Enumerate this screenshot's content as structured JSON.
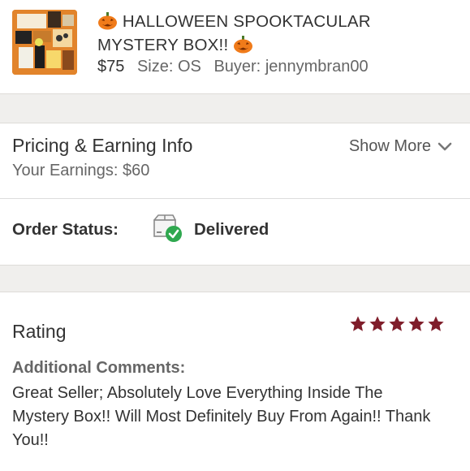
{
  "product": {
    "title_line1": "HALLOWEEN SPOOKTACULAR",
    "title_line2": "MYSTERY BOX!!",
    "price": "$75",
    "size_label": "Size:",
    "size_value": "OS",
    "buyer_label": "Buyer:",
    "buyer_value": "jennymbran00"
  },
  "pricing": {
    "title": "Pricing & Earning Info",
    "earnings": "Your Earnings: $60",
    "show_more": "Show More"
  },
  "order": {
    "label": "Order Status:",
    "value": "Delivered"
  },
  "rating": {
    "title": "Rating",
    "stars": 5,
    "comments_label": "Additional Comments:",
    "comments": "Great Seller; Absolutely Love Everything Inside The Mystery Box!! Will Most Definitely Buy From Again!! Thank You!!"
  },
  "colors": {
    "star": "#7f1d2a",
    "check": "#2fa84f",
    "band": "#f0efed",
    "pumpkin": "#f07b1a"
  },
  "icons": {
    "pumpkin": "pumpkin-icon",
    "chevron": "chevron-down-icon",
    "delivered": "package-delivered-icon",
    "star": "star-icon"
  }
}
